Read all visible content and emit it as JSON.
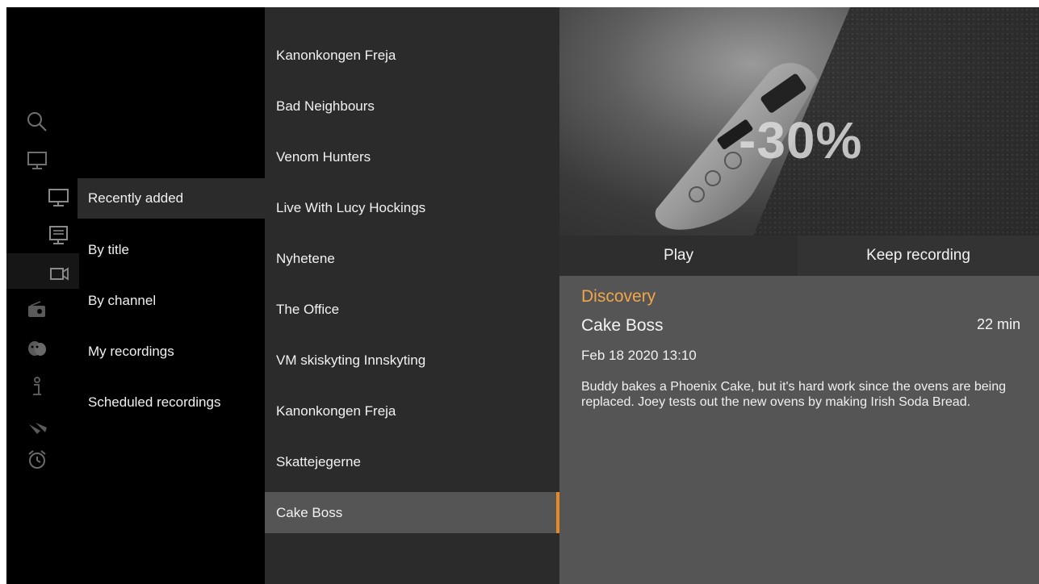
{
  "rail_icons": [
    "search-icon",
    "tv-icon",
    "radio-icon",
    "theater-masks-icon",
    "info-icon",
    "satellite-dish-icon",
    "alarm-clock-icon"
  ],
  "sub_icons": [
    "tv-outline-icon",
    "monitor-guide-icon",
    "video-camera-icon"
  ],
  "submenu": {
    "items": [
      {
        "label": "Recently added"
      },
      {
        "label": "By title"
      },
      {
        "label": "By channel"
      },
      {
        "label": "My recordings"
      },
      {
        "label": "Scheduled recordings"
      }
    ],
    "active_index": 0
  },
  "program_list": {
    "items": [
      {
        "title": "Kanonkongen Freja"
      },
      {
        "title": "Bad Neighbours"
      },
      {
        "title": "Venom Hunters"
      },
      {
        "title": "Live With Lucy Hockings"
      },
      {
        "title": "Nyhetene"
      },
      {
        "title": "The Office"
      },
      {
        "title": "VM skiskyting Innskyting"
      },
      {
        "title": "Kanonkongen Freja"
      },
      {
        "title": "Skattejegerne"
      },
      {
        "title": "Cake Boss"
      }
    ],
    "selected_index": 9
  },
  "detail": {
    "hero_text": "-30%",
    "actions": {
      "play": "Play",
      "keep": "Keep recording"
    },
    "channel": "Discovery",
    "title": "Cake Boss",
    "duration": "22 min",
    "datetime": "Feb 18 2020  13:10",
    "description": "Buddy bakes a Phoenix Cake, but it's hard work since the ovens are being replaced. Joey tests out the new ovens by making Irish Soda Bread."
  },
  "colors": {
    "accent": "#e78a24",
    "channel": "#f0a64a",
    "panel": "#555555",
    "list_bg": "#2b2b2b"
  }
}
